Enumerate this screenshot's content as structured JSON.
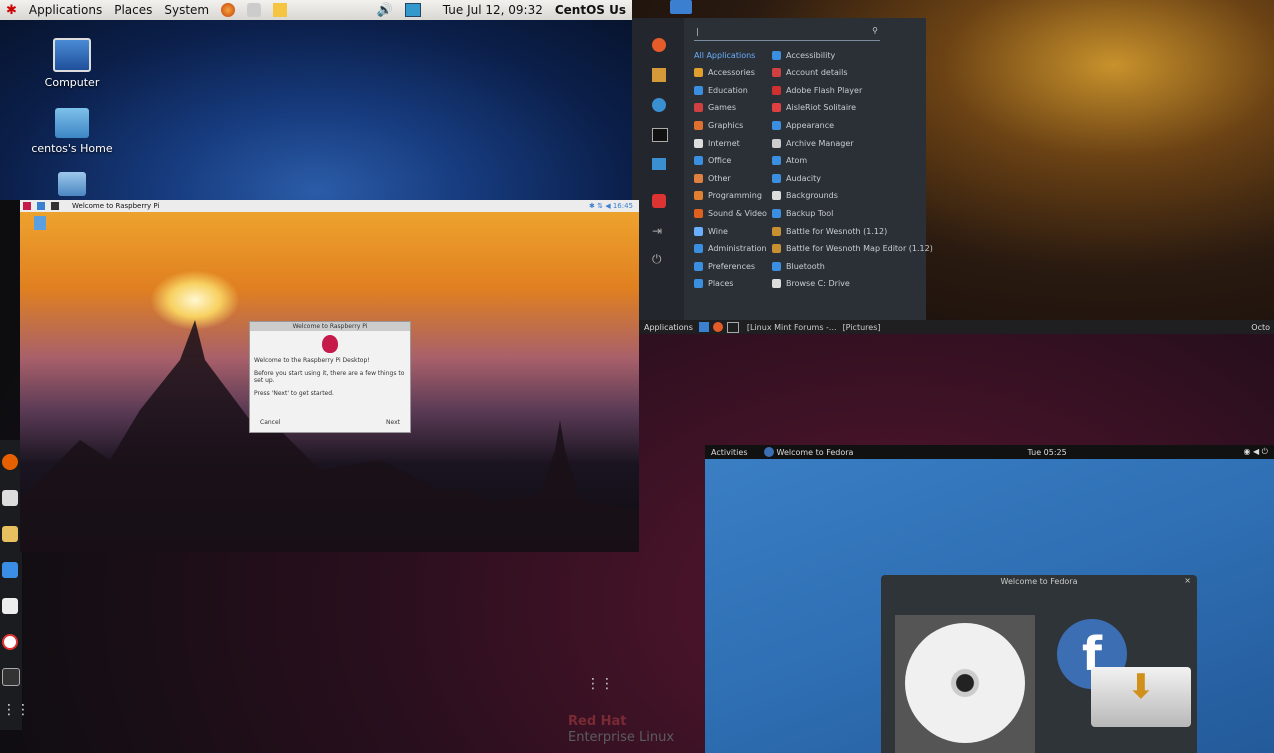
{
  "centos": {
    "menus": [
      "Applications",
      "Places",
      "System"
    ],
    "clock": "Tue Jul 12, 09:32",
    "user": "CentOS Us",
    "desktop_icons": [
      {
        "label": "Computer",
        "icon": "computer-icon"
      },
      {
        "label": "centos's Home",
        "icon": "home-folder-icon"
      },
      {
        "label": "",
        "icon": "trash-icon"
      }
    ]
  },
  "xfce_menu": {
    "search_placeholder": "",
    "categories": [
      "All Applications",
      "Accessories",
      "Education",
      "Games",
      "Graphics",
      "Internet",
      "Office",
      "Other",
      "Programming",
      "Sound & Video",
      "Wine",
      "Administration",
      "Preferences",
      "Places"
    ],
    "apps": [
      "Accessibility",
      "Account details",
      "Adobe Flash Player",
      "AisleRiot Solitaire",
      "Appearance",
      "Archive Manager",
      "Atom",
      "Audacity",
      "Backgrounds",
      "Backup Tool",
      "Battle for Wesnoth (1.12)",
      "Battle for Wesnoth Map Editor (1.12)",
      "Bluetooth",
      "Browse C: Drive"
    ]
  },
  "xfce_panel": {
    "apps_label": "Applications",
    "task1": "[Linux Mint Forums -...",
    "task2": "[Pictures]",
    "clock": "Octo"
  },
  "raspberry": {
    "window_title": "Welcome to Raspberry Pi",
    "dialog_title": "Welcome to Raspberry Pi",
    "dialog_heading": "Welcome to the Raspberry Pi Desktop!",
    "dialog_line1": "Before you start using it, there are a few things to set up.",
    "dialog_line2": "Press 'Next' to get started.",
    "cancel": "Cancel",
    "next": "Next"
  },
  "fedora": {
    "activities": "Activities",
    "app_name": "Welcome to Fedora",
    "clock": "Tue 05:25",
    "window_title": "Welcome to Fedora"
  },
  "rhel": {
    "brand_line1": "Red Hat",
    "brand_line2": "Enterprise Linux"
  },
  "colors": {
    "centos_panel": "#e6e4df",
    "fedora_blue": "#3b7fc4",
    "menu_bg": "#2b2f36",
    "rhel_red": "#8a1f3c"
  }
}
